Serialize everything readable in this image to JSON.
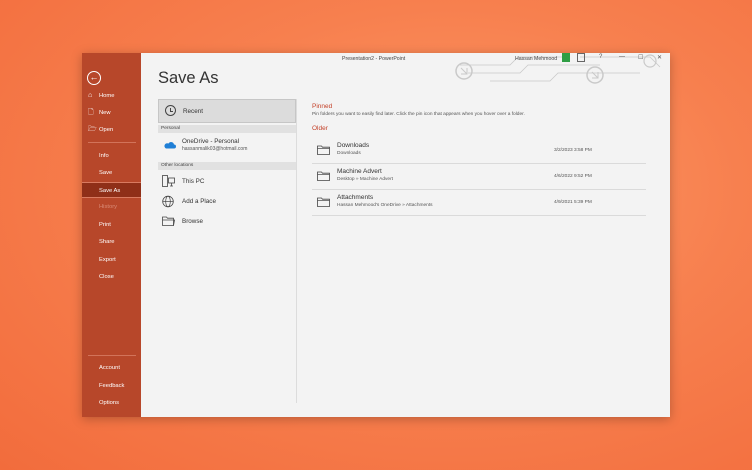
{
  "window": {
    "title": "Presentation2 - PowerPoint",
    "user": "Hassan Mehmood",
    "help": "?",
    "minimize": "—",
    "maximize": "☐",
    "close": "✕"
  },
  "sidebar": {
    "back_icon": "back-arrow-icon",
    "items": [
      {
        "label": "Home",
        "icon": "⌂"
      },
      {
        "label": "New",
        "icon": "🗋"
      },
      {
        "label": "Open",
        "icon": "🗁"
      },
      {
        "label": "Info"
      },
      {
        "label": "Save"
      },
      {
        "label": "Save As"
      },
      {
        "label": "History"
      },
      {
        "label": "Print"
      },
      {
        "label": "Share"
      },
      {
        "label": "Export"
      },
      {
        "label": "Close"
      },
      {
        "label": "Account"
      },
      {
        "label": "Feedback"
      },
      {
        "label": "Options"
      }
    ],
    "color": "#b7472a"
  },
  "page_title": "Save As",
  "locations": {
    "recent": "Recent",
    "personal_header": "Personal",
    "onedrive_name": "OneDrive - Personal",
    "onedrive_email": "hassanmalik03@hotmail.com",
    "other_header": "Other locations",
    "this_pc": "This PC",
    "add_place": "Add a Place",
    "browse": "Browse"
  },
  "pinned": {
    "header": "Pinned",
    "description": "Pin folders you want to easily find later. Click the pin icon that appears when you hover over a folder."
  },
  "older": {
    "header": "Older",
    "folders": [
      {
        "name": "Downloads",
        "path": "Downloads",
        "date": "3/2/2023 3:58 PM"
      },
      {
        "name": "Machine Advert",
        "path": "Desktop » Machine Advert",
        "date": "4/6/2022 9:52 PM"
      },
      {
        "name": "Attachments",
        "path": "Hassan Mehmood's OneDrive » Attachments",
        "date": "4/9/2021 5:39 PM"
      }
    ]
  },
  "accent_color": "#c4422a"
}
